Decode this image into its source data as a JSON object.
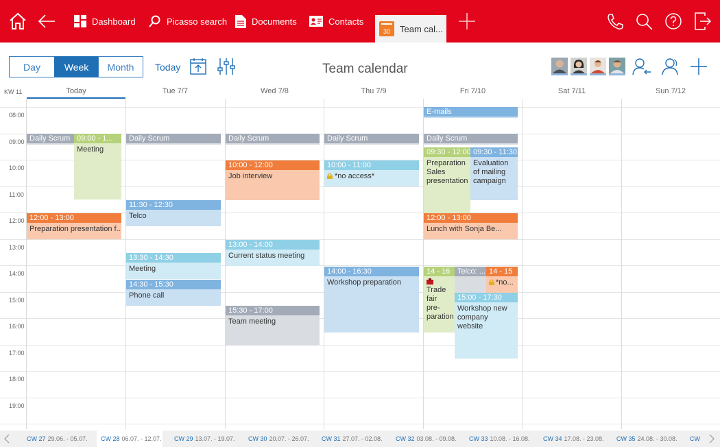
{
  "nav": {
    "dashboard": "Dashboard",
    "picasso_search": "Picasso search",
    "documents": "Documents",
    "contacts": "Contacts",
    "active_tab": "Team cal...",
    "tab_icon_day": "30"
  },
  "toolbar": {
    "views": [
      "Day",
      "Week",
      "Month"
    ],
    "active_view": "Week",
    "today": "Today",
    "title": "Team calendar"
  },
  "week_label": "KW 11",
  "days": [
    "Today",
    "Tue 7/7",
    "Wed 7/8",
    "Thu 7/9",
    "Fri 7/10",
    "Sat 7/11",
    "Sun 7/12"
  ],
  "hours": [
    "08:00",
    "09:00",
    "10:00",
    "11:00",
    "12:00",
    "13:00",
    "14:00",
    "15:00",
    "16:00",
    "17:00",
    "18:00",
    "19:00"
  ],
  "events": [
    {
      "id": "e1",
      "header": "E-mails",
      "body": "",
      "color": "#7fb3e0"
    },
    {
      "id": "e2",
      "header": "Daily Scrum",
      "body": "",
      "color": "#a4abb8"
    },
    {
      "id": "e3",
      "header": "09:00 - 1...",
      "body": "Meeting",
      "color": "#b5d27a"
    },
    {
      "id": "e4",
      "header": "Daily Scrum",
      "body": "",
      "color": "#a4abb8"
    },
    {
      "id": "e5",
      "header": "Daily Scrum",
      "body": "",
      "color": "#a4abb8"
    },
    {
      "id": "e6",
      "header": "Daily Scrum",
      "body": "",
      "color": "#a4abb8"
    },
    {
      "id": "e7",
      "header": "Daily Scrum",
      "body": "",
      "color": "#a4abb8"
    },
    {
      "id": "e8",
      "header": "09:30 - 12:00",
      "body": "Preparation Sales presentation",
      "color": "#b5d27a"
    },
    {
      "id": "e9",
      "header": "09:30 - 11:30",
      "body": "Evaluation of mailing campaign",
      "color": "#7fb3e0"
    },
    {
      "id": "e10",
      "header": "10:00 - 12:00",
      "body": "Job interview",
      "color": "#f07d3c"
    },
    {
      "id": "e11",
      "header": "10:00 - 11:00",
      "body": "*no access*",
      "color": "#8fd0e6"
    },
    {
      "id": "e12",
      "header": "11:30 - 12:30",
      "body": "Telco",
      "color": "#7fb3e0"
    },
    {
      "id": "e13",
      "header": "12:00 - 13:00",
      "body": "Preparation presentation f...",
      "color": "#f07d3c"
    },
    {
      "id": "e14",
      "header": "12:00 - 13:00",
      "body": "Lunch with Sonja Be...",
      "color": "#f07d3c"
    },
    {
      "id": "e15",
      "header": "13:00 - 14:00",
      "body": "Current status meeting",
      "color": "#8fd0e6"
    },
    {
      "id": "e16",
      "header": "13:30 - 14:30",
      "body": "Meeting",
      "color": "#8fd0e6"
    },
    {
      "id": "e17",
      "header": "14:30 - 15:30",
      "body": "Phone call",
      "color": "#7fb3e0"
    },
    {
      "id": "e18",
      "header": "14:00 - 16:30",
      "body": "Workshop preparation",
      "color": "#7fb3e0"
    },
    {
      "id": "e19",
      "header": "14 - 16",
      "body": "Trade fair pre-paration",
      "color": "#b5d27a"
    },
    {
      "id": "e20",
      "header": "Telco: ...",
      "body": "",
      "color": "#a4abb8"
    },
    {
      "id": "e21",
      "header": "14 - 15",
      "body": "*no...",
      "color": "#f07d3c"
    },
    {
      "id": "e22",
      "header": "15:00 - 17:30",
      "body": "Workshop new company website",
      "color": "#8fd0e6"
    },
    {
      "id": "e23",
      "header": "15:30 - 17:00",
      "body": "Team meeting",
      "color": "#a4abb8"
    }
  ],
  "calendar_weeks": [
    {
      "week": "CW 27",
      "range": "29.06. - 05.07."
    },
    {
      "week": "CW 28",
      "range": "06.07. - 12.07."
    },
    {
      "week": "CW 29",
      "range": "13.07. - 19.07."
    },
    {
      "week": "CW 30",
      "range": "20.07. - 26.07."
    },
    {
      "week": "CW 31",
      "range": "27.07. - 02.08."
    },
    {
      "week": "CW 32",
      "range": "03.08. - 09.08."
    },
    {
      "week": "CW 33",
      "range": "10.08. - 16.08."
    },
    {
      "week": "CW 34",
      "range": "17.08. - 23.08."
    },
    {
      "week": "CW 35",
      "range": "24.08. - 30.08."
    },
    {
      "week": "CW",
      "range": ""
    }
  ]
}
